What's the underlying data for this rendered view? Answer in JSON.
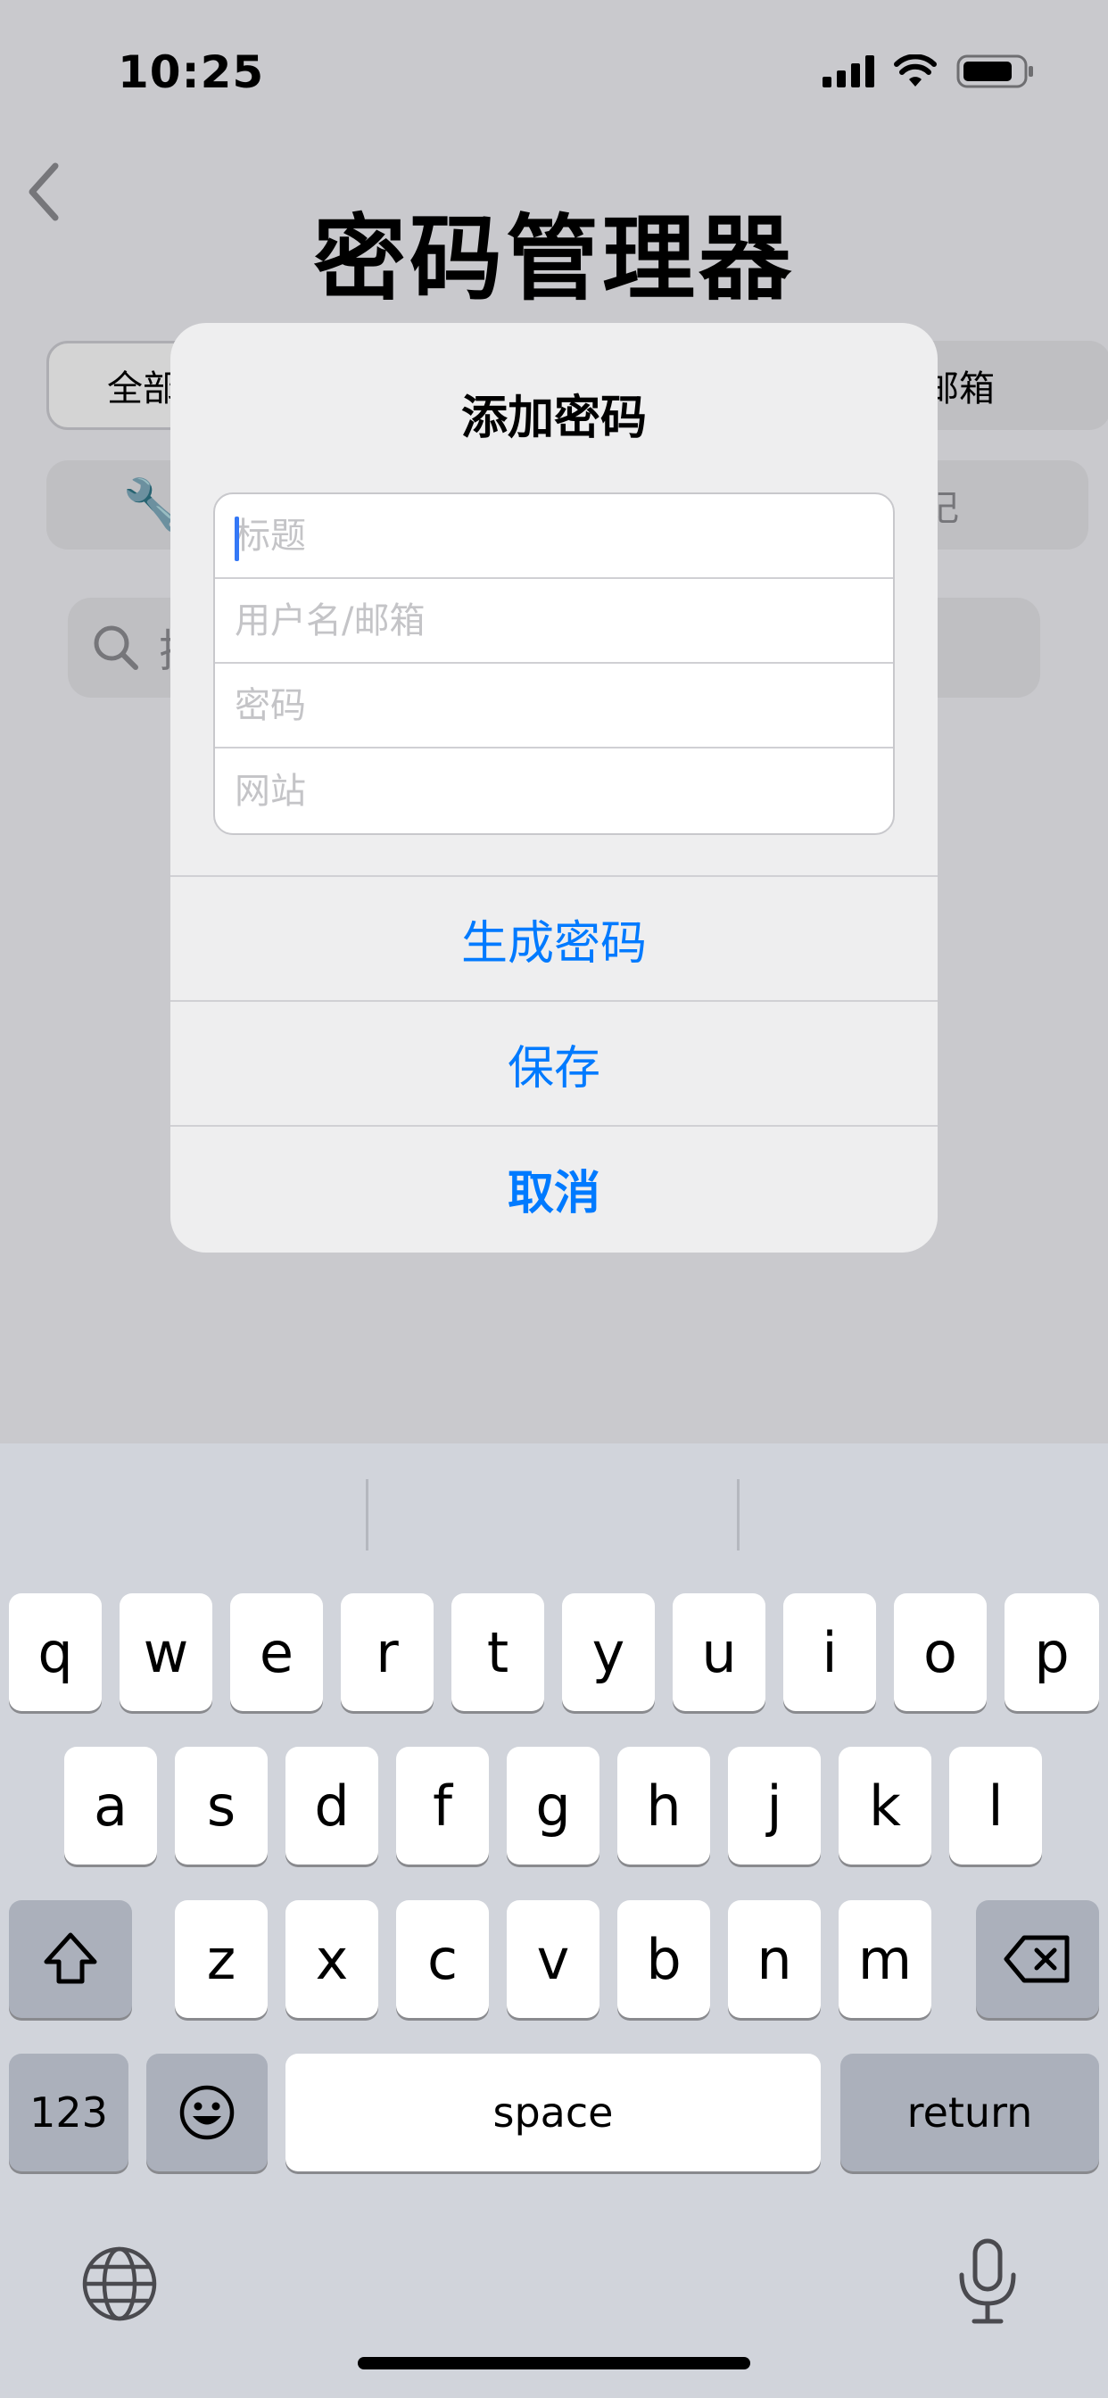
{
  "status_bar": {
    "time": "10:25"
  },
  "app": {
    "title": "密码管理器",
    "filters": {
      "all": "全部",
      "email": "邮箱",
      "tool_icon": "🔧",
      "note": "记"
    },
    "search_placeholder": "搜"
  },
  "alert": {
    "title": "添加密码",
    "fields": {
      "title_placeholder": "标题",
      "username_placeholder": "用户名/邮箱",
      "password_placeholder": "密码",
      "website_placeholder": "网站"
    },
    "buttons": {
      "generate": "生成密码",
      "save": "保存",
      "cancel": "取消"
    }
  },
  "keyboard": {
    "row1": [
      "q",
      "w",
      "e",
      "r",
      "t",
      "y",
      "u",
      "i",
      "o",
      "p"
    ],
    "row2": [
      "a",
      "s",
      "d",
      "f",
      "g",
      "h",
      "j",
      "k",
      "l"
    ],
    "row3": [
      "z",
      "x",
      "c",
      "v",
      "b",
      "n",
      "m"
    ],
    "numbers": "123",
    "space": "space",
    "return": "return"
  },
  "colors": {
    "accent": "#007aff",
    "keyboard_bg": "#d1d4db",
    "caret": "#3478f6"
  }
}
